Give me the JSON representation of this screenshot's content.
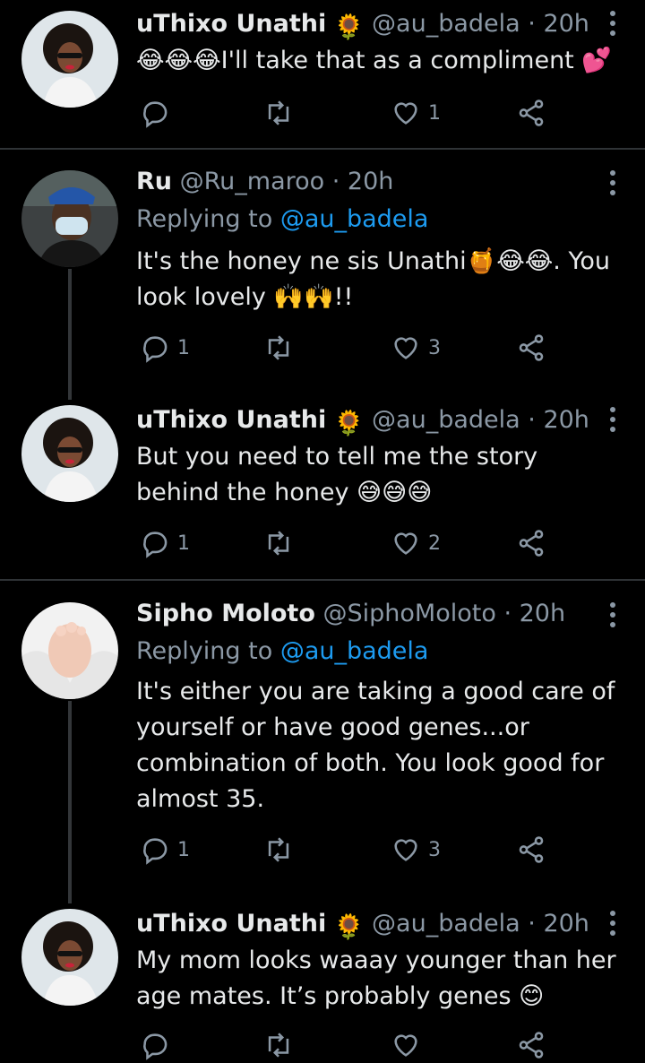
{
  "tweets": [
    {
      "name": "uThixo Unathi",
      "verified_emoji": "🌻",
      "handle": "@au_badela",
      "time": "· 20h",
      "replying_to": "",
      "text": "😂😂😂I'll take that as a compliment 💕",
      "reply_count": "",
      "retweet_count": "",
      "like_count": "1"
    },
    {
      "name": "Ru",
      "verified_emoji": "",
      "handle": "@Ru_maroo",
      "time": "· 20h",
      "replying_to_label": "Replying to",
      "replying_to": "@au_badela",
      "text": "It's the honey ne sis Unathi🍯😂😂. You look lovely 🙌🙌!!",
      "reply_count": "1",
      "retweet_count": "",
      "like_count": "3"
    },
    {
      "name": "uThixo Unathi",
      "verified_emoji": "🌻",
      "handle": "@au_badela",
      "time": "· 20h",
      "replying_to": "",
      "text": "But you need to tell me the story behind the honey 😅😅😅",
      "reply_count": "1",
      "retweet_count": "",
      "like_count": "2"
    },
    {
      "name": "Sipho Moloto",
      "verified_emoji": "",
      "handle": "@SiphoMoloto",
      "time": "· 20h",
      "replying_to_label": "Replying to",
      "replying_to": "@au_badela",
      "text": "It's either you are taking a good care of yourself or have good genes...or combination of both. You look good for almost 35.",
      "reply_count": "1",
      "retweet_count": "",
      "like_count": "3"
    },
    {
      "name": "uThixo Unathi",
      "verified_emoji": "🌻",
      "handle": "@au_badela",
      "time": "· 20h",
      "replying_to": "",
      "text": "My mom looks waaay younger than her age mates. It’s probably genes 😊",
      "reply_count": "",
      "retweet_count": "",
      "like_count": ""
    }
  ],
  "colors": {
    "background": "#000000",
    "text": "#e7e9ea",
    "muted": "#8b98a5",
    "link": "#1d9bf0",
    "divider": "#2f3336"
  },
  "icons": [
    "reply-icon",
    "retweet-icon",
    "like-icon",
    "share-icon",
    "more-icon"
  ]
}
